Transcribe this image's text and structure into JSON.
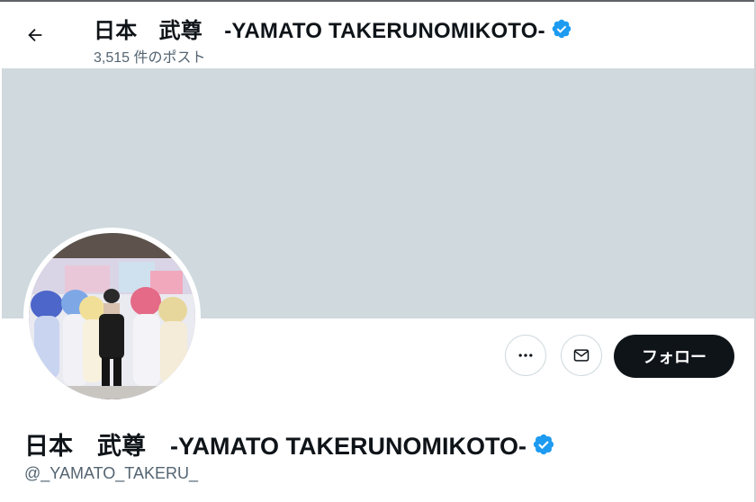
{
  "header": {
    "back_icon": "arrow-left-icon",
    "display_name": "日本　武尊　-YAMATO TAKERUNOMIKOTO-",
    "post_count_text": "3,515 件のポスト",
    "verified_icon": "verified-badge-icon"
  },
  "banner": {
    "color": "#cfd9de"
  },
  "profile": {
    "display_name": "日本　武尊　-YAMATO TAKERUNOMIKOTO-",
    "handle": "@_YAMATO_TAKERU_",
    "verified_icon": "verified-badge-icon",
    "avatar": "profile-photo"
  },
  "actions": {
    "more_icon": "more-dots-icon",
    "message_icon": "envelope-icon",
    "follow_label": "フォロー"
  },
  "colors": {
    "text_primary": "#0f1419",
    "text_secondary": "#536471",
    "verified_blue": "#1d9bf0",
    "button_dark": "#0f1419"
  }
}
